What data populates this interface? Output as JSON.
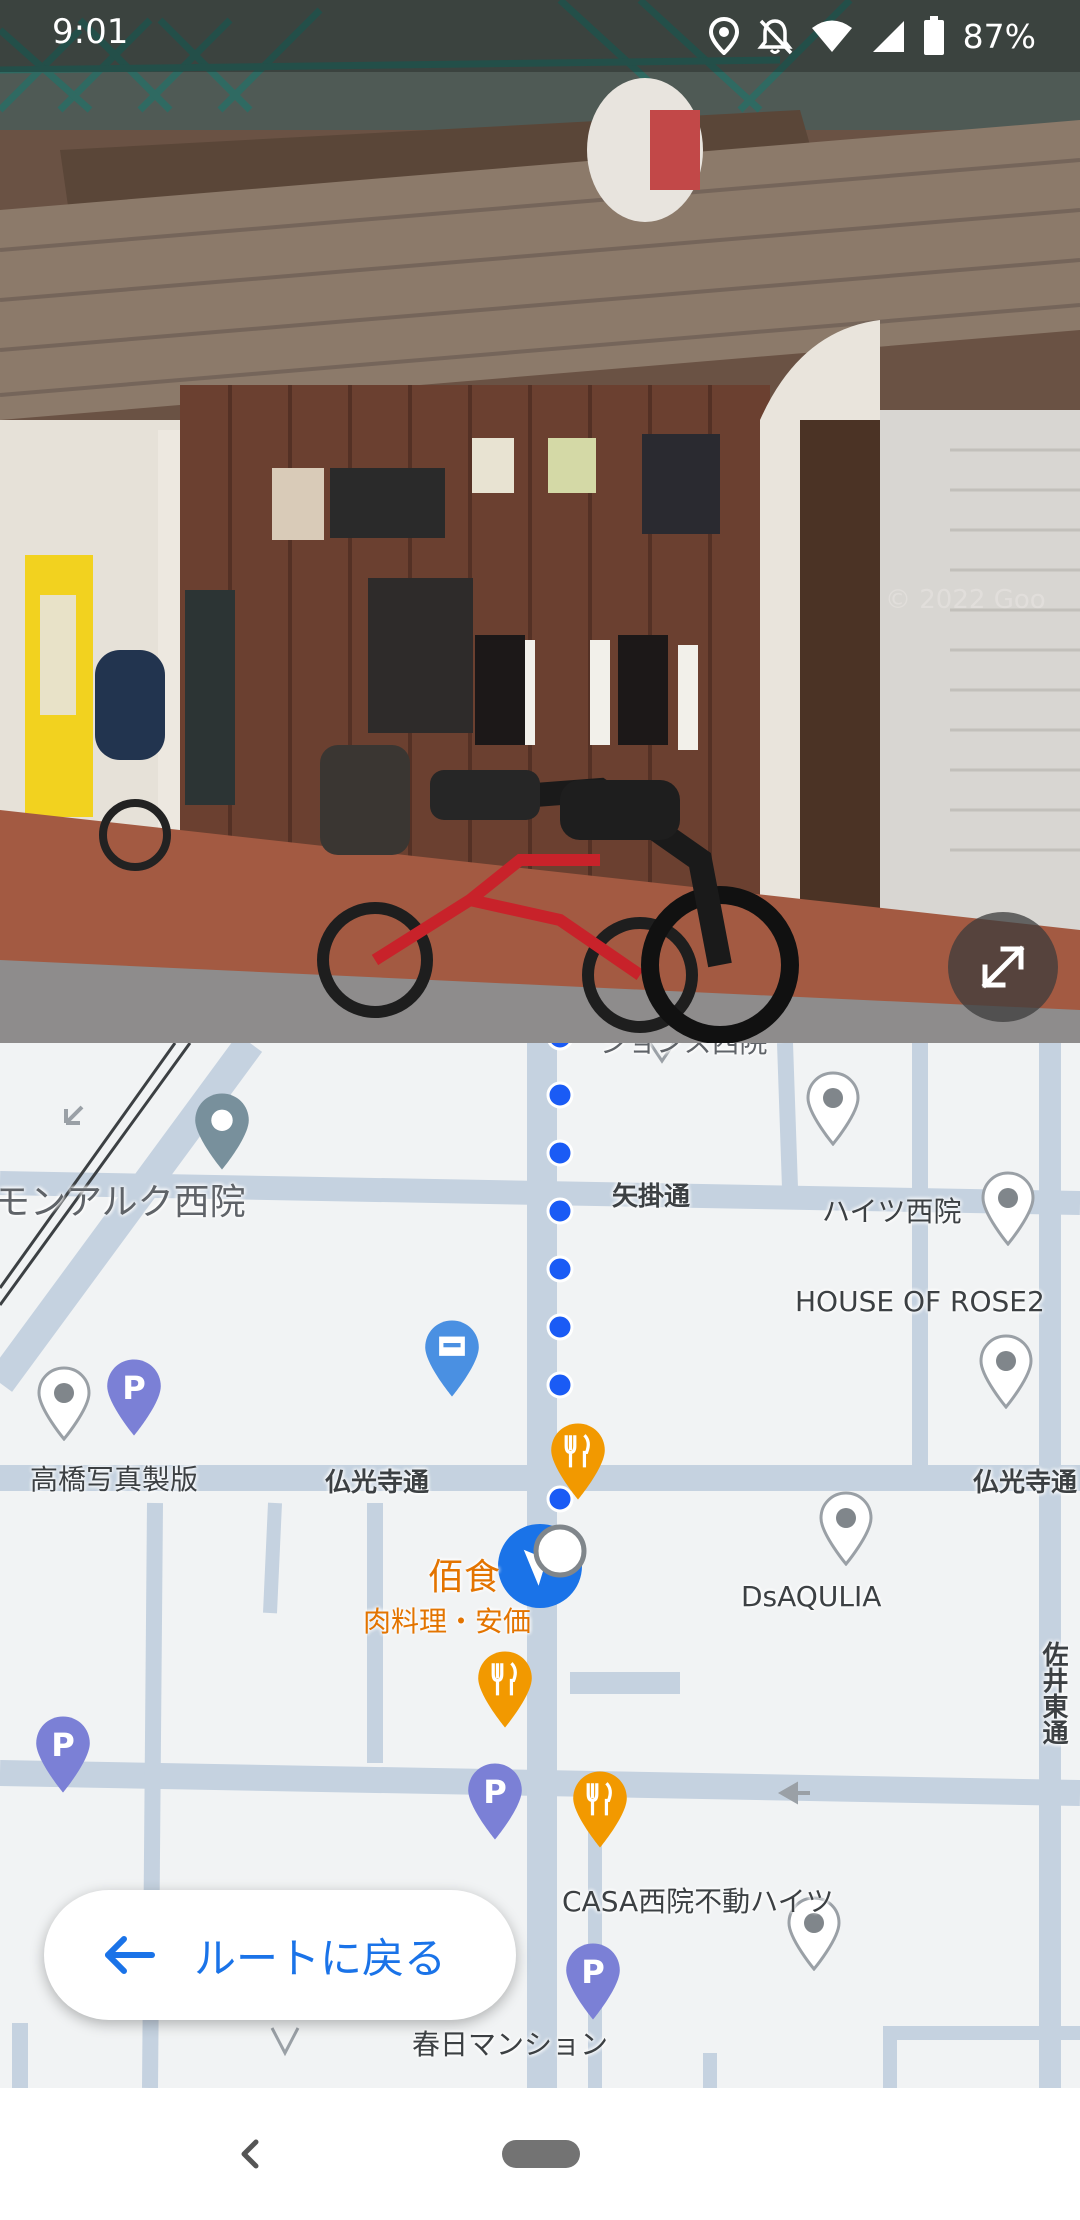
{
  "status_bar": {
    "time": "9:01",
    "battery": "87%",
    "icons": [
      "location-icon",
      "notifications-off-icon",
      "wifi-icon",
      "cell-signal-icon",
      "battery-icon"
    ]
  },
  "street_view": {
    "watermark": "© 2022 Goo",
    "expand_icon": "expand-icon"
  },
  "map": {
    "streets": {
      "yakakedori": "矢掛通",
      "bukkoujidori_left": "仏光寺通",
      "bukkoujidori_right": "仏光寺通",
      "saiihigashidori": "佐井東通"
    },
    "places": {
      "monarque": "モンアルク西院",
      "heights_saiin": "ハイツ西院",
      "house_of_rose": "HOUSE OF ROSE2",
      "takahashi": "高橋写真製版",
      "dsaqulia": "DsAQULIA",
      "casa": "CASA西院不動ハイツ",
      "kasuga": "春日マンション",
      "top_cut": "ジョンス西院"
    },
    "restaurant": {
      "name": "佰食",
      "category": "肉料理・安価"
    },
    "colors": {
      "route_dot": "#1a5bf5",
      "food_pin": "#f29900",
      "parking_pin": "#7b80d6",
      "accent": "#1a73e8"
    }
  },
  "back_to_route": {
    "label": "ルートに戻る",
    "icon": "arrow-left-icon"
  },
  "nav_bar": {
    "back_icon": "nav-back-icon",
    "home_icon": "nav-home-pill"
  }
}
